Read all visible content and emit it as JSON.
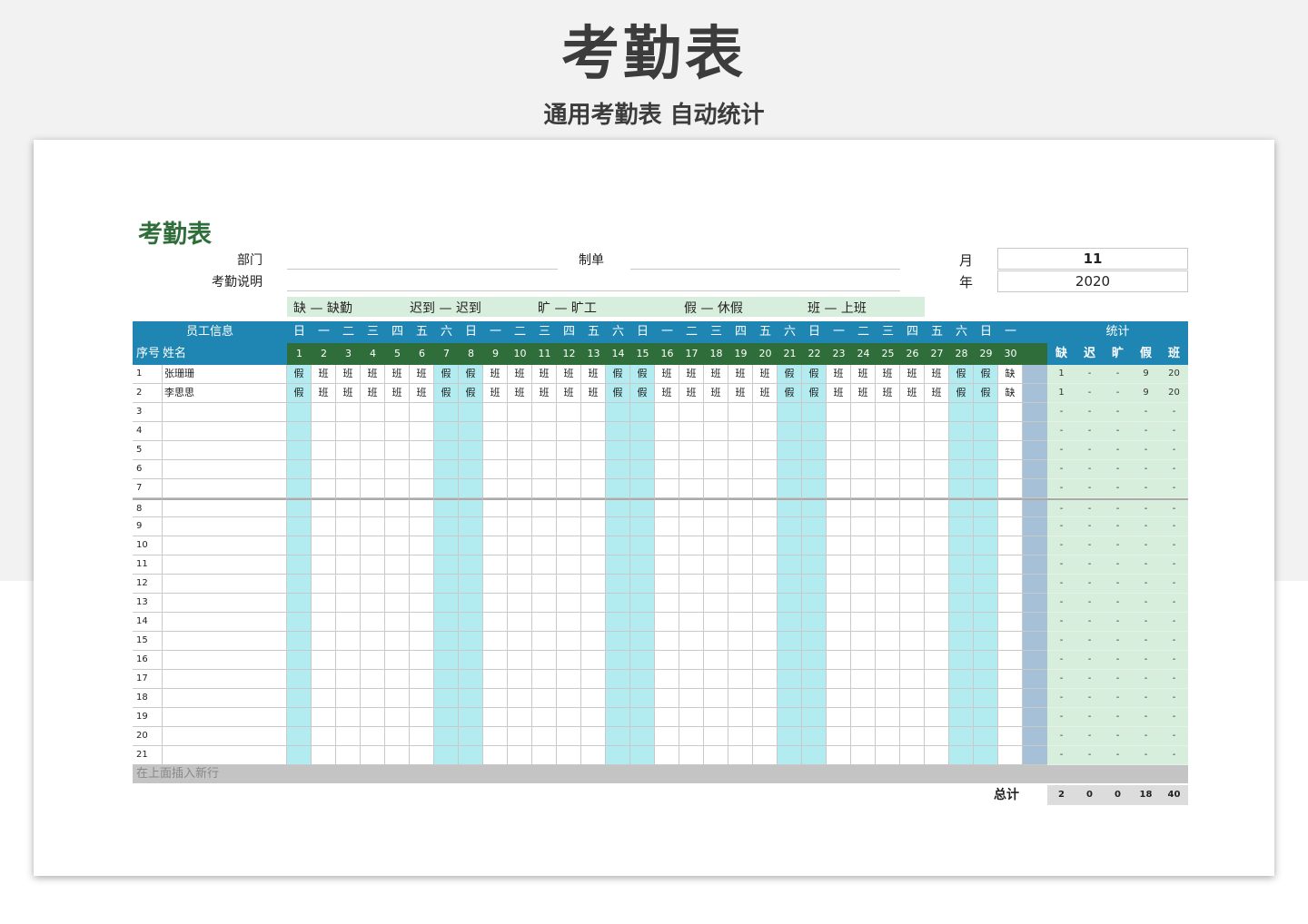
{
  "banner": {
    "title": "考勤表",
    "subtitle": "通用考勤表  自动统计"
  },
  "sheet": {
    "title": "考勤表",
    "fields": {
      "department_label": "部门",
      "description_label": "考勤说明",
      "maker_label": "制单",
      "month_label": "月",
      "month_value": "11",
      "year_label": "年",
      "year_value": "2020"
    },
    "legend": [
      "缺 — 缺勤",
      "迟到 — 迟到",
      "旷 — 旷工",
      "假 — 休假",
      "班 — 上班"
    ],
    "headers": {
      "employee_info": "员工信息",
      "seq": "序号",
      "name": "姓名",
      "stats": "统计",
      "stats_cols": [
        "缺",
        "迟",
        "旷",
        "假",
        "班"
      ]
    },
    "weekdays": [
      "日",
      "一",
      "二",
      "三",
      "四",
      "五",
      "六",
      "日",
      "一",
      "二",
      "三",
      "四",
      "五",
      "六",
      "日",
      "一",
      "二",
      "三",
      "四",
      "五",
      "六",
      "日",
      "一",
      "二",
      "三",
      "四",
      "五",
      "六",
      "日",
      "一"
    ],
    "days": [
      "1",
      "2",
      "3",
      "4",
      "5",
      "6",
      "7",
      "8",
      "9",
      "10",
      "11",
      "12",
      "13",
      "14",
      "15",
      "16",
      "17",
      "18",
      "19",
      "20",
      "21",
      "22",
      "23",
      "24",
      "25",
      "26",
      "27",
      "28",
      "29",
      "30"
    ],
    "rows": [
      {
        "seq": "1",
        "name": "张珊珊",
        "marks": [
          "假",
          "班",
          "班",
          "班",
          "班",
          "班",
          "假",
          "假",
          "班",
          "班",
          "班",
          "班",
          "班",
          "假",
          "假",
          "班",
          "班",
          "班",
          "班",
          "班",
          "假",
          "假",
          "班",
          "班",
          "班",
          "班",
          "班",
          "假",
          "假",
          "缺"
        ],
        "stats": [
          "1",
          "-",
          "-",
          "9",
          "20"
        ]
      },
      {
        "seq": "2",
        "name": "李思思",
        "marks": [
          "假",
          "班",
          "班",
          "班",
          "班",
          "班",
          "假",
          "假",
          "班",
          "班",
          "班",
          "班",
          "班",
          "假",
          "假",
          "班",
          "班",
          "班",
          "班",
          "班",
          "假",
          "假",
          "班",
          "班",
          "班",
          "班",
          "班",
          "假",
          "假",
          "缺"
        ],
        "stats": [
          "1",
          "-",
          "-",
          "9",
          "20"
        ]
      },
      {
        "seq": "3",
        "name": "",
        "marks": [],
        "stats": [
          "-",
          "-",
          "-",
          "-",
          "-"
        ]
      },
      {
        "seq": "4",
        "name": "",
        "marks": [],
        "stats": [
          "-",
          "-",
          "-",
          "-",
          "-"
        ]
      },
      {
        "seq": "5",
        "name": "",
        "marks": [],
        "stats": [
          "-",
          "-",
          "-",
          "-",
          "-"
        ]
      },
      {
        "seq": "6",
        "name": "",
        "marks": [],
        "stats": [
          "-",
          "-",
          "-",
          "-",
          "-"
        ]
      },
      {
        "seq": "7",
        "name": "",
        "marks": [],
        "stats": [
          "-",
          "-",
          "-",
          "-",
          "-"
        ]
      },
      {
        "seq": "8",
        "name": "",
        "marks": [],
        "stats": [
          "-",
          "-",
          "-",
          "-",
          "-"
        ]
      },
      {
        "seq": "9",
        "name": "",
        "marks": [],
        "stats": [
          "-",
          "-",
          "-",
          "-",
          "-"
        ]
      },
      {
        "seq": "10",
        "name": "",
        "marks": [],
        "stats": [
          "-",
          "-",
          "-",
          "-",
          "-"
        ]
      },
      {
        "seq": "11",
        "name": "",
        "marks": [],
        "stats": [
          "-",
          "-",
          "-",
          "-",
          "-"
        ]
      },
      {
        "seq": "12",
        "name": "",
        "marks": [],
        "stats": [
          "-",
          "-",
          "-",
          "-",
          "-"
        ]
      },
      {
        "seq": "13",
        "name": "",
        "marks": [],
        "stats": [
          "-",
          "-",
          "-",
          "-",
          "-"
        ]
      },
      {
        "seq": "14",
        "name": "",
        "marks": [],
        "stats": [
          "-",
          "-",
          "-",
          "-",
          "-"
        ]
      },
      {
        "seq": "15",
        "name": "",
        "marks": [],
        "stats": [
          "-",
          "-",
          "-",
          "-",
          "-"
        ]
      },
      {
        "seq": "16",
        "name": "",
        "marks": [],
        "stats": [
          "-",
          "-",
          "-",
          "-",
          "-"
        ]
      },
      {
        "seq": "17",
        "name": "",
        "marks": [],
        "stats": [
          "-",
          "-",
          "-",
          "-",
          "-"
        ]
      },
      {
        "seq": "18",
        "name": "",
        "marks": [],
        "stats": [
          "-",
          "-",
          "-",
          "-",
          "-"
        ]
      },
      {
        "seq": "19",
        "name": "",
        "marks": [],
        "stats": [
          "-",
          "-",
          "-",
          "-",
          "-"
        ]
      },
      {
        "seq": "20",
        "name": "",
        "marks": [],
        "stats": [
          "-",
          "-",
          "-",
          "-",
          "-"
        ]
      },
      {
        "seq": "21",
        "name": "",
        "marks": [],
        "stats": [
          "-",
          "-",
          "-",
          "-",
          "-"
        ]
      }
    ],
    "insert_hint": "在上面插入新行",
    "total_label": "总计",
    "totals": [
      "2",
      "0",
      "0",
      "18",
      "40"
    ]
  },
  "colors": {
    "header_blue": "#1f86b3",
    "header_green": "#2f6e3a",
    "weekend_cyan": "#b2ecf1",
    "stats_green": "#d8eedd",
    "gap_column": "#a6c0d8",
    "insert_row": "#c4c4c4"
  }
}
